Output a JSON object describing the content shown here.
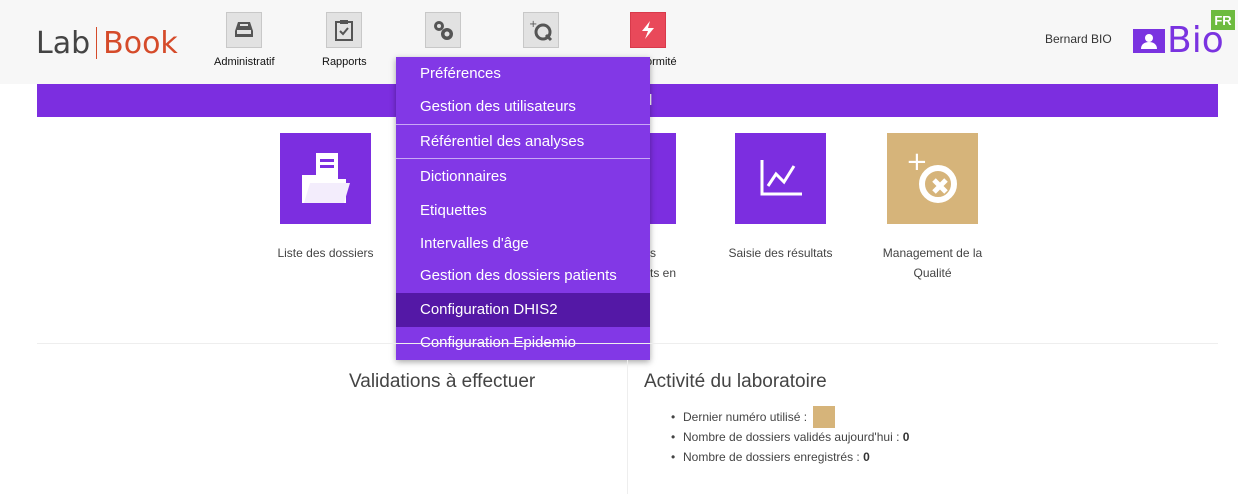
{
  "header": {
    "logo": {
      "part1": "Lab",
      "part2": "Book"
    },
    "nav": [
      {
        "label": "Administratif",
        "icon": "inbox-tray-icon"
      },
      {
        "label": "Rapports",
        "icon": "clipboard-check-icon"
      },
      {
        "label": "",
        "icon": "gears-icon"
      },
      {
        "label": "",
        "icon": "quality-cross-icon"
      },
      {
        "label": "ormité",
        "icon": "lightning-icon"
      }
    ],
    "user": "Bernard BIO",
    "bio_logo": "Bio",
    "language": "FR"
  },
  "banner": {
    "text": "l"
  },
  "tiles": [
    {
      "label": "Liste des dossiers",
      "icon": "folder-document-icon",
      "color": "#7c2ee0"
    },
    {
      "label_line1": "s",
      "label_line2": "ts en",
      "icon": "partially-hidden-tile",
      "color": "#7c2ee0"
    },
    {
      "label": "Saisie des résultats",
      "icon": "line-chart-icon",
      "color": "#7c2ee0"
    },
    {
      "label_line1": "Management de la",
      "label_line2": "Qualité",
      "icon": "quality-cross-icon",
      "color": "#d6b47a"
    }
  ],
  "dropdown": {
    "items": [
      "Préférences",
      "Gestion des utilisateurs",
      "Référentiel des analyses",
      "Dictionnaires",
      "Etiquettes",
      "Intervalles d'âge",
      "Gestion des dossiers patients",
      "Configuration DHIS2",
      "Configuration Epidemio"
    ],
    "active": "Configuration DHIS2"
  },
  "validations": {
    "title": "Validations à effectuer"
  },
  "activity": {
    "title": "Activité du laboratoire",
    "items": [
      {
        "label": "Dernier numéro utilisé :",
        "value": ""
      },
      {
        "label": "Nombre de dossiers validés aujourd'hui :",
        "value": "0"
      },
      {
        "label": "Nombre de dossiers enregistrés :",
        "value": "0"
      }
    ]
  },
  "colors": {
    "primary": "#7c2ee0",
    "menu": "#8238e6",
    "menu_active": "#5418a6",
    "gold": "#d6b47a",
    "logo_red": "#d54b2a",
    "fr_green": "#6dbb3f"
  }
}
